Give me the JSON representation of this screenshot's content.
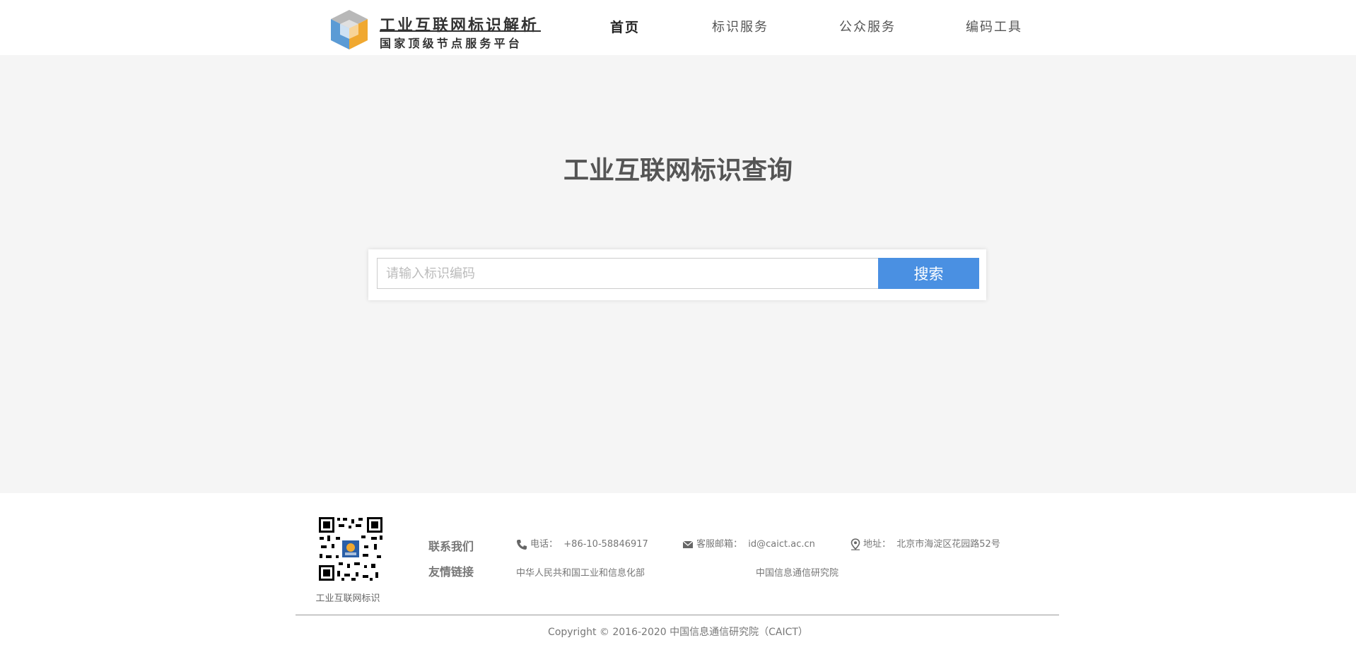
{
  "header": {
    "logo_title": "工业互联网标识解析",
    "logo_subtitle": "国家顶级节点服务平台",
    "nav": [
      "首页",
      "标识服务",
      "公众服务",
      "编码工具"
    ],
    "active_nav": "首页"
  },
  "main": {
    "title": "工业互联网标识查询",
    "search": {
      "placeholder": "请输入标识编码",
      "value": "",
      "button_label": "搜索"
    }
  },
  "footer": {
    "qr_label": "工业互联网标识",
    "contact_heading": "联系我们",
    "links_heading": "友情链接",
    "phone": {
      "label": "电话：",
      "value": "+86-10-58846917",
      "icon": "phone-icon"
    },
    "email": {
      "label": "客服邮箱：",
      "value": "id@caict.ac.cn",
      "icon": "mail-icon"
    },
    "address": {
      "label": "地址：",
      "value": "北京市海淀区花园路52号",
      "icon": "location-icon"
    },
    "links": [
      "中华人民共和国工业和信息化部",
      "中国信息通信研究院"
    ],
    "copyright": "Copyright © 2016-2020 中国信息通信研究院（CAICT）"
  },
  "colors": {
    "accent": "#4a90e2",
    "main_bg": "#f5f5f5",
    "logo_blue": "#5b9bd5",
    "logo_orange": "#f0a830"
  }
}
